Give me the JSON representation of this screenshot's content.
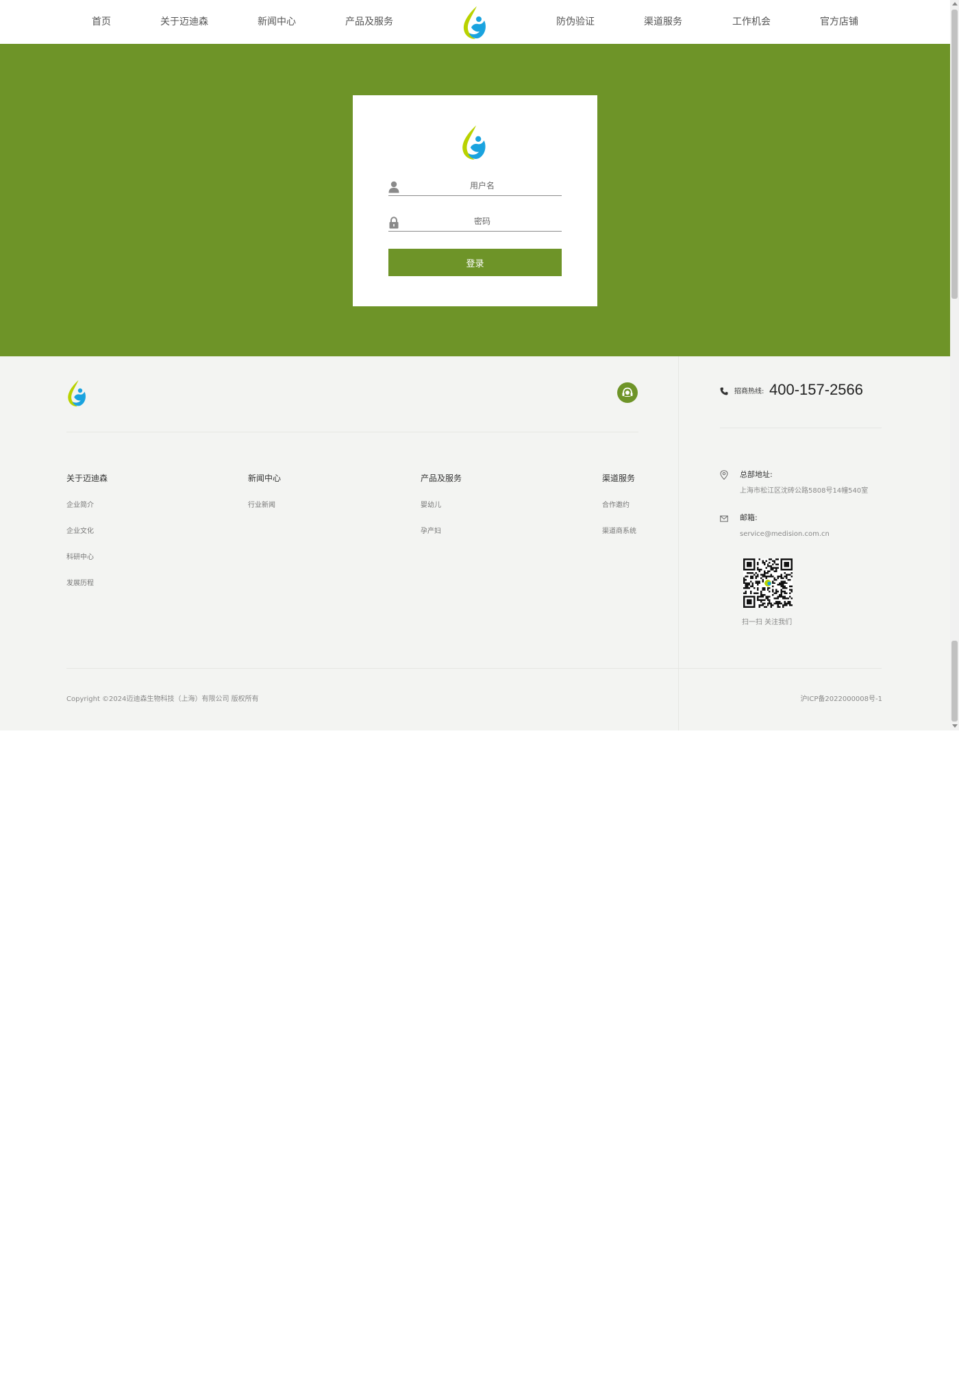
{
  "nav": {
    "items": [
      "首页",
      "关于迈迪森",
      "新闻中心",
      "产品及服务",
      "防伪验证",
      "渠道服务",
      "工作机会",
      "官方店铺"
    ]
  },
  "login": {
    "username_placeholder": "用户名",
    "password_placeholder": "密码",
    "submit_label": "登录"
  },
  "footer": {
    "hotline_label": "招商热线:",
    "hotline_number": "400-157-2566",
    "columns": [
      {
        "title": "关于迈迪森",
        "links": [
          "企业简介",
          "企业文化",
          "科研中心",
          "发展历程"
        ]
      },
      {
        "title": "新闻中心",
        "links": [
          "行业新闻"
        ]
      },
      {
        "title": "产品及服务",
        "links": [
          "婴幼儿",
          "孕产妇"
        ]
      },
      {
        "title": "渠道服务",
        "links": [
          "合作邀约",
          "渠道商系统"
        ]
      }
    ],
    "address_title": "总部地址:",
    "address_value": "上海市松江区沈砖公路5808号14幢540室",
    "email_title": "邮箱:",
    "email_value": "service@medision.com.cn",
    "qr_caption": "扫一扫 关注我们",
    "copyright": "Copyright ©2024迈迪森生物科技（上海）有限公司 版权所有",
    "icp": "沪ICP备2022000008号-1"
  },
  "colors": {
    "brand_green": "#6e9428",
    "logo_yellow": "#b9d200",
    "logo_blue": "#1aa3df",
    "footer_bg": "#f3f4f2"
  },
  "icons": [
    "brand-logo",
    "user-icon",
    "lock-icon",
    "customer-service-icon",
    "phone-icon",
    "location-pin-icon",
    "mail-icon",
    "qr-code"
  ]
}
